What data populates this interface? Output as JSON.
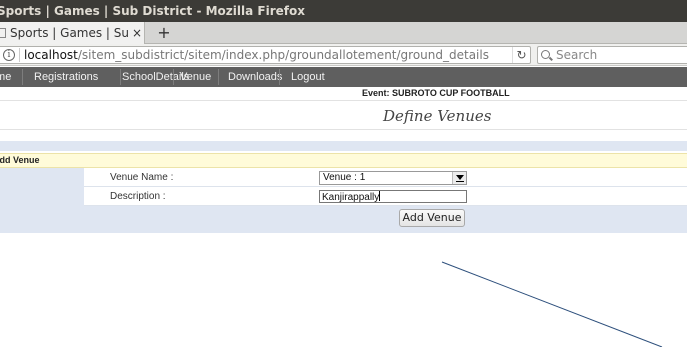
{
  "window": {
    "title": "Sports | Games | Sub District - Mozilla Firefox"
  },
  "tab": {
    "title": "Sports | Games | Sub District",
    "close_glyph": "×",
    "new_tab_glyph": "+"
  },
  "navbar": {
    "url_host": "localhost",
    "url_path": "/sitem_subdistrict/sitem/index.php/groundallotement/ground_details",
    "info_glyph": "i",
    "reload_glyph": "↻",
    "search_placeholder": "Search"
  },
  "menu": {
    "items": [
      "Home",
      "Registrations",
      "SchoolDetails",
      "Venue",
      "Downloads",
      "Logout"
    ]
  },
  "page": {
    "event_title": "Event: SUBROTO CUP FOOTBALL",
    "heading": "Define Venues",
    "section_header": "Add Venue"
  },
  "form": {
    "venue_name_label": "Venue Name :",
    "venue_selected": "Venue : 1",
    "description_label": "Description :",
    "description_value": "Kanjirappally",
    "submit_label": "Add Venue"
  },
  "colors": {
    "menubar_bg": "#5f5f5f",
    "section_header_bg": "#fffbd9",
    "form_accent_bg": "#dfe6f2",
    "annotation_line": "#2d4f7c"
  }
}
